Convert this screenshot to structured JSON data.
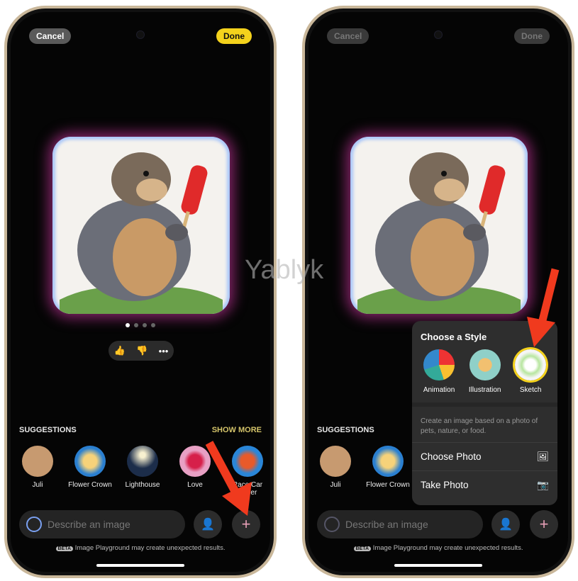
{
  "left": {
    "cancel": "Cancel",
    "done": "Done"
  },
  "right": {
    "cancel": "Cancel",
    "done": "Done"
  },
  "suggestions": {
    "title": "SUGGESTIONS",
    "show_more": "SHOW MORE",
    "items": [
      {
        "label": "Juli",
        "color": "#c79a70"
      },
      {
        "label": "Flower Crown",
        "color": "#2a7fd0"
      },
      {
        "label": "Lighthouse",
        "color": "#1c2d4a"
      },
      {
        "label": "Love",
        "color": "#e8a0c4"
      },
      {
        "label": "Race Car Driver",
        "color": "#2a86d8"
      }
    ]
  },
  "input": {
    "placeholder": "Describe an image"
  },
  "beta": {
    "badge": "BETA",
    "text": "Image Playground may create unexpected results."
  },
  "popover": {
    "title": "Choose a Style",
    "styles": [
      {
        "label": "Animation",
        "selected": false
      },
      {
        "label": "Illustration",
        "selected": false
      },
      {
        "label": "Sketch",
        "selected": true
      }
    ],
    "description": "Create an image based on a photo of pets, nature, or food.",
    "choose_photo": "Choose Photo",
    "take_photo": "Take Photo"
  },
  "page_dots": {
    "count": 4,
    "active": 1
  },
  "watermark": "Yablyk",
  "colors": {
    "accent": "#f4d21c",
    "arrow": "#f03a1e"
  }
}
